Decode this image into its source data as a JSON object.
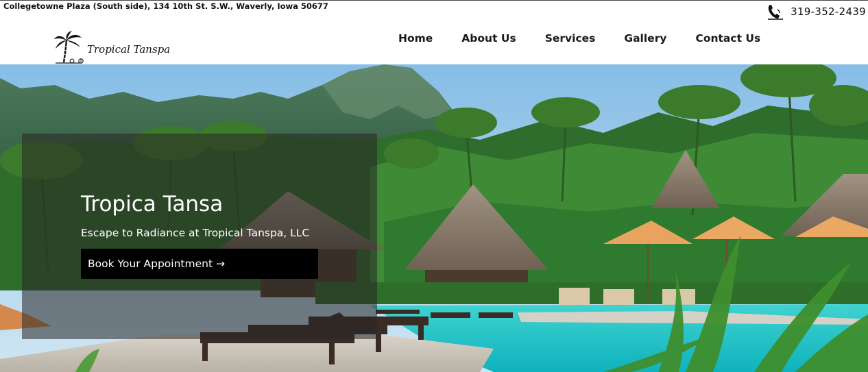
{
  "header": {
    "address": "Collegetowne Plaza (South side), 134 10th St. S.W., Waverly, Iowa 50677",
    "phone": "319-352-2439",
    "phone_icon": "phone-handset-icon",
    "logo_text": "Tropical Tanspa",
    "logo_icon": "palm-tree-icon"
  },
  "nav": {
    "items": [
      {
        "label": "Home"
      },
      {
        "label": "About Us"
      },
      {
        "label": "Services"
      },
      {
        "label": "Gallery"
      },
      {
        "label": "Contact Us"
      }
    ]
  },
  "hero": {
    "title": "Tropica Tansa",
    "subtitle": "Escape to Radiance at Tropical Tanspa, LLC",
    "cta_label": "Book Your Appointment →",
    "image_subject": "tropical resort pool with palm trees, thatched huts and mountains"
  },
  "colors": {
    "overlay": "rgba(40,38,36,0.55)",
    "cta_background": "#000000",
    "pool": "#1fc4c8",
    "sky": "#9fcbe8"
  }
}
